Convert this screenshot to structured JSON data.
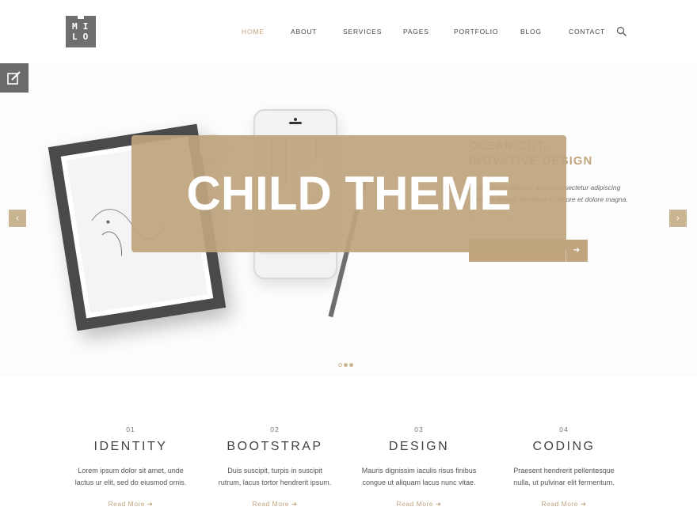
{
  "logo": {
    "text_top": "MI",
    "text_bottom": "LO"
  },
  "nav": {
    "items": [
      {
        "label": "HOME",
        "active": true
      },
      {
        "label": "ABOUT",
        "active": false
      },
      {
        "label": "SERVICES",
        "active": false
      },
      {
        "label": "PAGES",
        "active": false
      },
      {
        "label": "PORTFOLIO",
        "active": false
      },
      {
        "label": "BLOG",
        "active": false
      },
      {
        "label": "CONTACT",
        "active": false
      }
    ],
    "search_icon": "search-icon"
  },
  "hero": {
    "title_line1": "CLEAN CUT,",
    "title_line2": "INOVATIVE DESIGN",
    "text": "Lorem ipsum dolor sit amet, consectetur adipiscing eiusmod tempor incididunt ut labore et dolore magna.",
    "social_icons": [
      "facebook-icon",
      "twitter-icon",
      "google-plus-icon"
    ],
    "button_arrow": "➔",
    "prev_arrow": "‹",
    "next_arrow": "›",
    "slides": 3,
    "active_slide": 1
  },
  "overlay": {
    "text": "CHILD THEME"
  },
  "features": [
    {
      "num": "01",
      "title": "IDENTITY",
      "desc_line1": "Lorem ipsum dolor sit amet, unde",
      "desc_line2": "lactus ur elit, sed do eiusmod omis.",
      "link": "Read More"
    },
    {
      "num": "02",
      "title": "BOOTSTRAP",
      "desc_line1": "Duis suscipit, turpis in suscipit",
      "desc_line2": "rutrum, lacus tortor hendrerit ipsum.",
      "link": "Read More"
    },
    {
      "num": "03",
      "title": "DESIGN",
      "desc_line1": "Mauris dignissim iaculis risus finibus",
      "desc_line2": "congue ut aliquam lacus nunc vitae.",
      "link": "Read More"
    },
    {
      "num": "04",
      "title": "CODING",
      "desc_line1": "Praesent hendrerit pellentesque",
      "desc_line2": "nulla, ut pulvinar elit fermentum.",
      "link": "Read More"
    }
  ],
  "colors": {
    "accent": "#c1a57f",
    "overlay": "#bea57e",
    "logo_bg": "#6e6e6e"
  }
}
